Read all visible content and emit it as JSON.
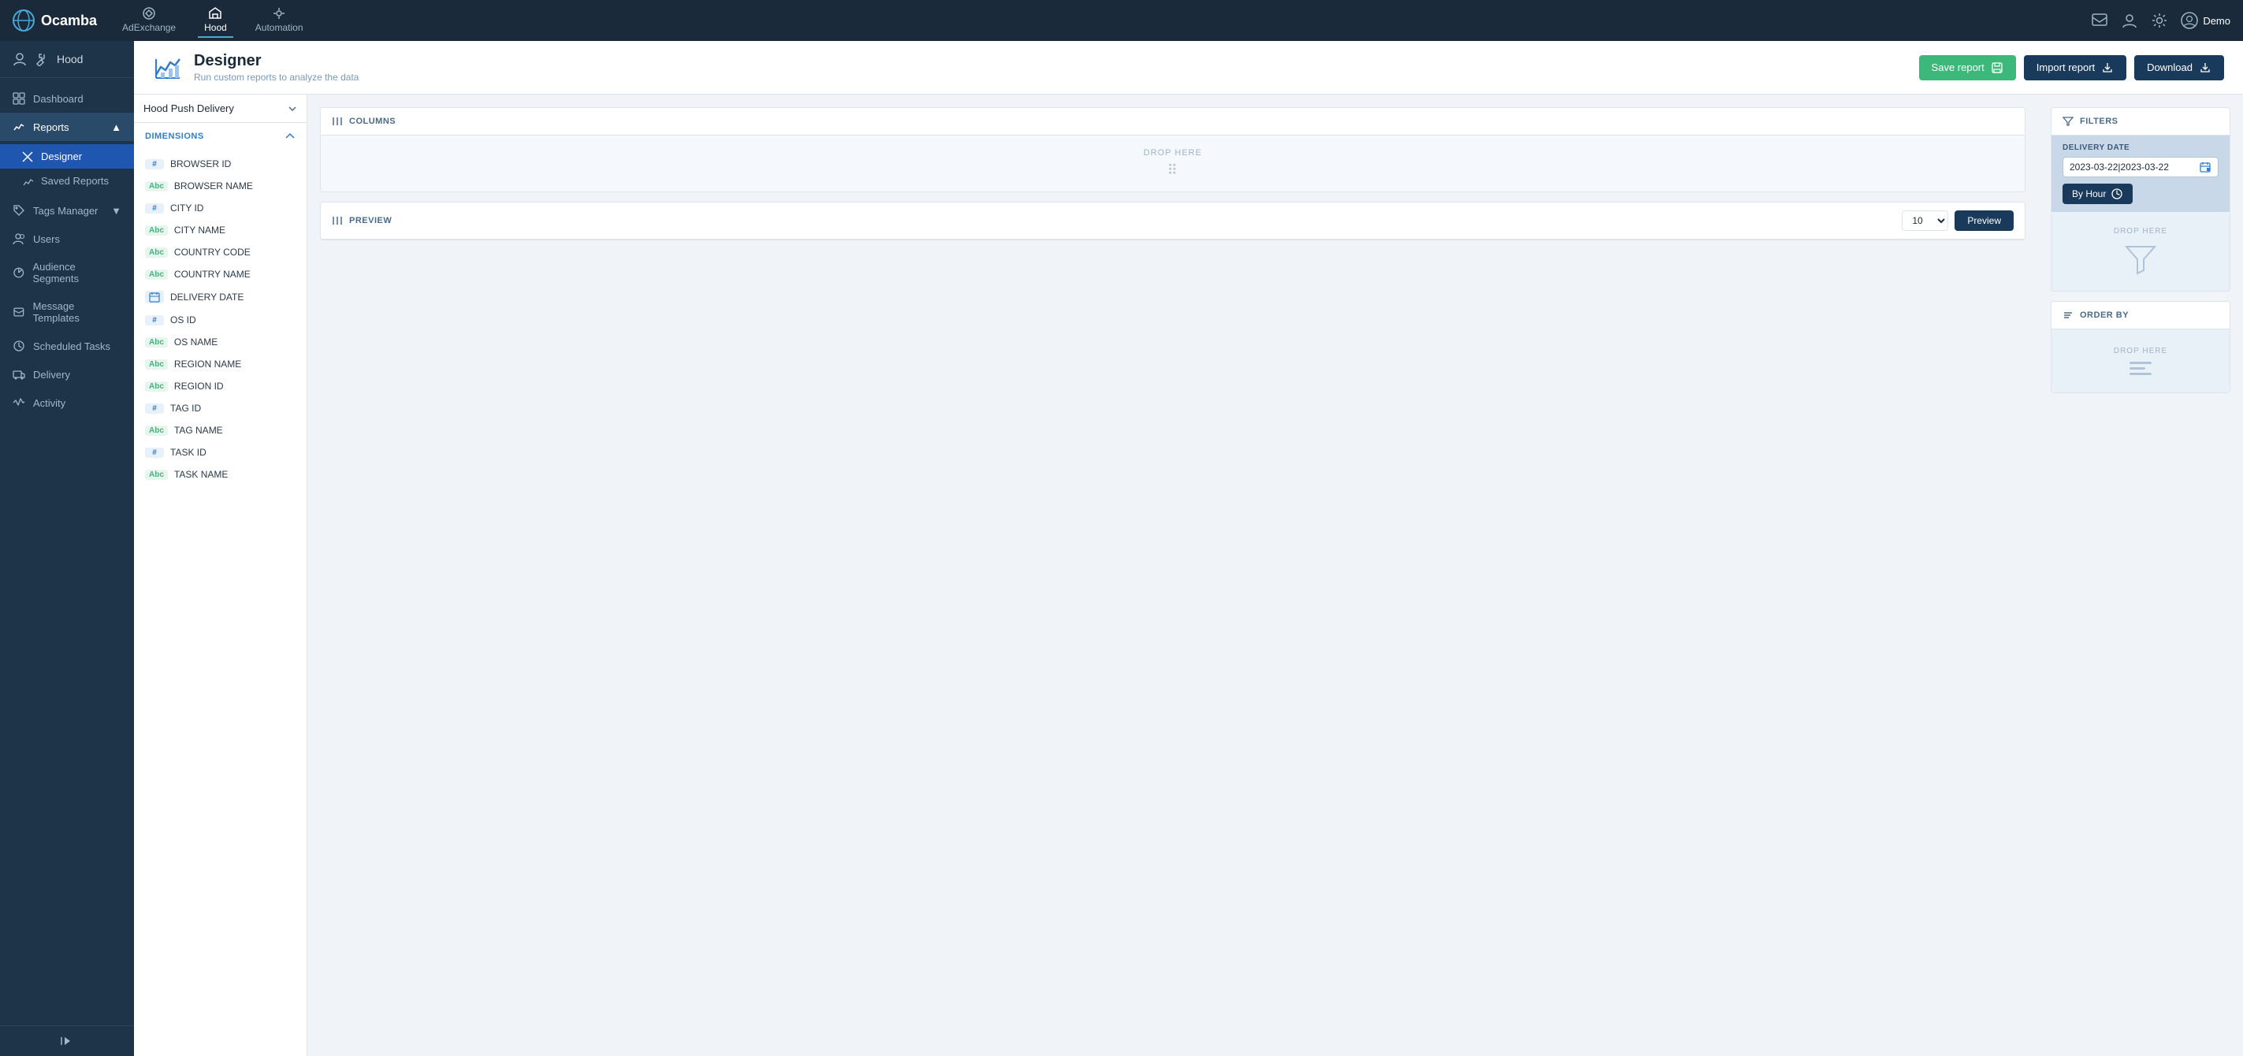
{
  "app": {
    "name": "Ocamba",
    "logo_icon": "globe-icon"
  },
  "top_nav": {
    "items": [
      {
        "label": "AdExchange",
        "icon": "adexchange-icon",
        "active": false
      },
      {
        "label": "Hood",
        "icon": "hood-icon",
        "active": true
      },
      {
        "label": "Automation",
        "icon": "automation-icon",
        "active": false
      }
    ],
    "right_icons": [
      "message-icon",
      "user-icon",
      "settings-icon"
    ],
    "user_label": "Demo"
  },
  "sidebar": {
    "section_icon": "person-icon",
    "section_tools_icon": "tools-icon",
    "title": "Hood",
    "items": [
      {
        "label": "Dashboard",
        "icon": "dashboard-icon",
        "active": false
      },
      {
        "label": "Reports",
        "icon": "reports-icon",
        "active": true,
        "expanded": true
      },
      {
        "label": "Designer",
        "icon": "designer-icon",
        "active": true,
        "sub": true
      },
      {
        "label": "Saved Reports",
        "icon": "saved-icon",
        "active": false,
        "sub": true
      },
      {
        "label": "Tags Manager",
        "icon": "tags-icon",
        "active": false,
        "expandable": true
      },
      {
        "label": "Users",
        "icon": "users-icon",
        "active": false
      },
      {
        "label": "Audience Segments",
        "icon": "segments-icon",
        "active": false
      },
      {
        "label": "Message Templates",
        "icon": "templates-icon",
        "active": false
      },
      {
        "label": "Scheduled Tasks",
        "icon": "tasks-icon",
        "active": false
      },
      {
        "label": "Delivery",
        "icon": "delivery-icon",
        "active": false
      },
      {
        "label": "Activity",
        "icon": "activity-icon",
        "active": false
      }
    ],
    "collapse_label": "Collapse"
  },
  "page_header": {
    "icon": "designer-chart-icon",
    "title": "Designer",
    "subtitle": "Run custom reports to analyze the data",
    "save_button": "Save report",
    "import_button": "Import report",
    "download_button": "Download"
  },
  "dimensions_panel": {
    "dropdown_value": "Hood Push Delivery",
    "section_title": "DIMENSIONS",
    "items": [
      {
        "tag": "#",
        "label": "BROWSER ID",
        "type": "hash"
      },
      {
        "tag": "Abc",
        "label": "BROWSER NAME",
        "type": "abc"
      },
      {
        "tag": "#",
        "label": "CITY ID",
        "type": "hash"
      },
      {
        "tag": "Abc",
        "label": "CITY NAME",
        "type": "abc"
      },
      {
        "tag": "Abc",
        "label": "COUNTRY CODE",
        "type": "abc"
      },
      {
        "tag": "Abc",
        "label": "COUNTRY NAME",
        "type": "abc"
      },
      {
        "tag": "📅",
        "label": "DELIVERY DATE",
        "type": "date"
      },
      {
        "tag": "#",
        "label": "OS ID",
        "type": "hash"
      },
      {
        "tag": "Abc",
        "label": "OS NAME",
        "type": "abc"
      },
      {
        "tag": "Abc",
        "label": "REGION NAME",
        "type": "abc"
      },
      {
        "tag": "Abc",
        "label": "REGION ID",
        "type": "abc"
      },
      {
        "tag": "#",
        "label": "TAG ID",
        "type": "hash"
      },
      {
        "tag": "Abc",
        "label": "TAG NAME",
        "type": "abc"
      },
      {
        "tag": "#",
        "label": "TASK ID",
        "type": "hash"
      },
      {
        "tag": "Abc",
        "label": "TASK NAME",
        "type": "abc"
      }
    ]
  },
  "columns_section": {
    "title": "COLUMNS",
    "drop_label": "DROP HERE"
  },
  "preview_section": {
    "title": "PREVIEW",
    "row_count": "10",
    "button_label": "Preview"
  },
  "filters_section": {
    "title": "FILTERS",
    "delivery_date_label": "DELIVERY DATE",
    "date_value": "2023-03-22|2023-03-22",
    "by_hour_label": "By Hour",
    "drop_label": "DROP HERE"
  },
  "order_section": {
    "title": "ORDER BY",
    "drop_label": "DROP HERE"
  }
}
